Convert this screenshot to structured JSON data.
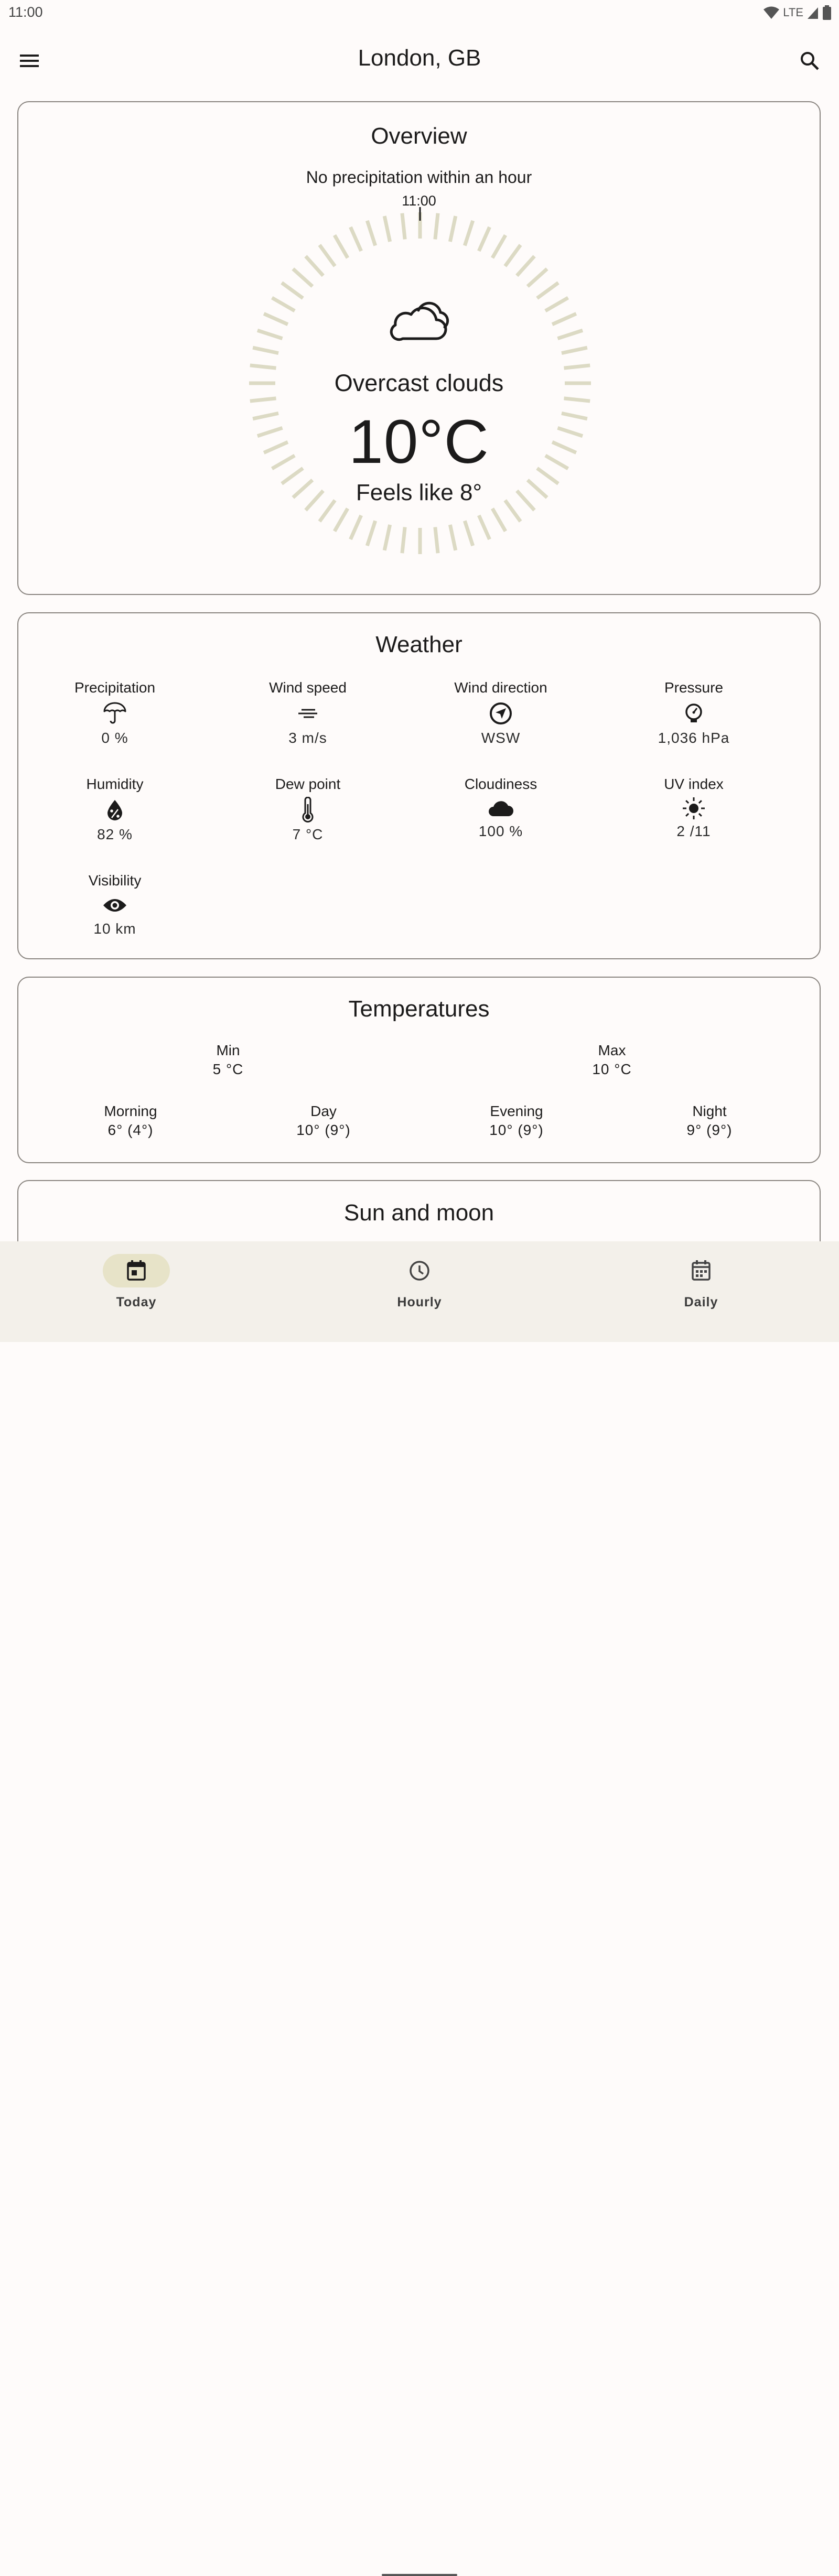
{
  "status_bar": {
    "time": "11:00",
    "network": "LTE"
  },
  "app_bar": {
    "title": "London, GB",
    "menu_icon": "menu-icon",
    "search_icon": "search-icon"
  },
  "overview": {
    "title": "Overview",
    "precipitation_text": "No precipitation within an hour",
    "tick_time": "11:00",
    "condition_icon": "cloud-icon",
    "condition": "Overcast clouds",
    "temperature": "10°C",
    "feels_like": "Feels like 8°",
    "dial_color": "#dcdac4"
  },
  "weather": {
    "title": "Weather",
    "items": [
      {
        "label": "Precipitation",
        "icon": "umbrella-icon",
        "value": "0 %"
      },
      {
        "label": "Wind speed",
        "icon": "wind-icon",
        "value": "3 m/s"
      },
      {
        "label": "Wind direction",
        "icon": "wind-direction-icon",
        "value": "WSW"
      },
      {
        "label": "Pressure",
        "icon": "gauge-icon",
        "value": "1,036 hPa"
      },
      {
        "label": "Humidity",
        "icon": "humidity-icon",
        "value": "82 %"
      },
      {
        "label": "Dew point",
        "icon": "thermometer-icon",
        "value": "7 °C"
      },
      {
        "label": "Cloudiness",
        "icon": "cloud-icon",
        "value": "100 %"
      },
      {
        "label": "UV index",
        "icon": "sun-icon",
        "value": "2 /11"
      },
      {
        "label": "Visibility",
        "icon": "eye-icon",
        "value": "10 km"
      }
    ]
  },
  "temperatures": {
    "title": "Temperatures",
    "min": {
      "label": "Min",
      "value": "5 °C"
    },
    "max": {
      "label": "Max",
      "value": "10 °C"
    },
    "periods": [
      {
        "label": "Morning",
        "value": "6° (4°)"
      },
      {
        "label": "Day",
        "value": "10° (9°)"
      },
      {
        "label": "Evening",
        "value": "10° (9°)"
      },
      {
        "label": "Night",
        "value": "9° (9°)"
      }
    ]
  },
  "sun_moon": {
    "title": "Sun and moon"
  },
  "nav": {
    "items": [
      {
        "label": "Today",
        "icon": "calendar-today-icon",
        "active": true
      },
      {
        "label": "Hourly",
        "icon": "clock-icon",
        "active": false
      },
      {
        "label": "Daily",
        "icon": "calendar-icon",
        "active": false
      }
    ]
  },
  "colors": {
    "background": "#fefbfa",
    "nav_background": "#f3f0ea",
    "active_pill": "#e7e3c8",
    "card_border": "#8a8580"
  }
}
